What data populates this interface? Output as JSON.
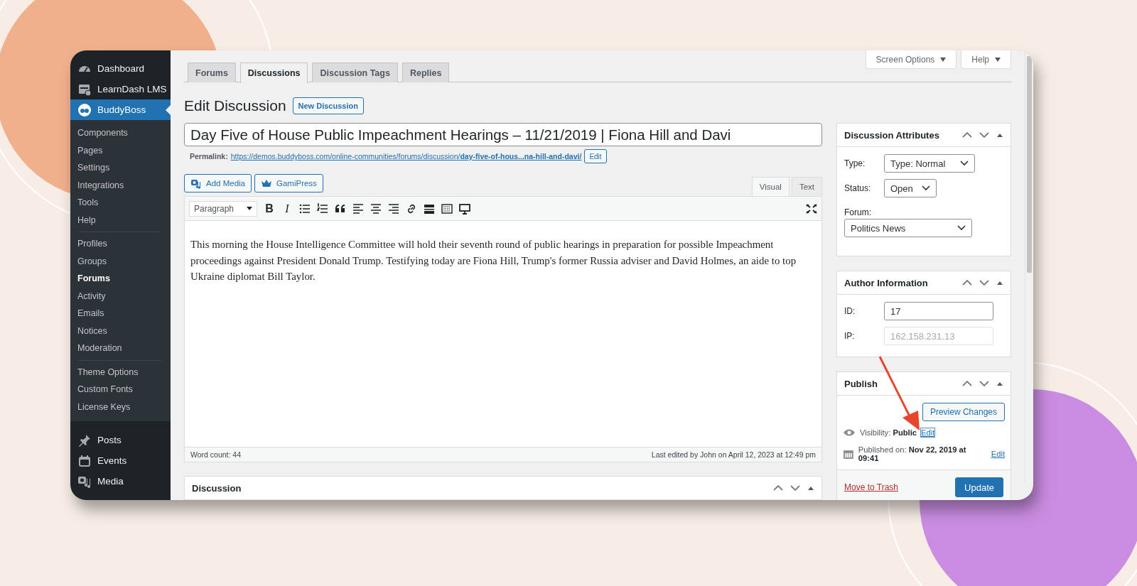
{
  "sidebar": {
    "top_items": [
      {
        "label": "Dashboard",
        "selected": false
      },
      {
        "label": "LearnDash LMS",
        "selected": false
      },
      {
        "label": "BuddyBoss",
        "selected": true
      }
    ],
    "submenu_groups": [
      [
        {
          "label": "Components",
          "selected": false
        },
        {
          "label": "Pages",
          "selected": false
        },
        {
          "label": "Settings",
          "selected": false
        },
        {
          "label": "Integrations",
          "selected": false
        },
        {
          "label": "Tools",
          "selected": false
        },
        {
          "label": "Help",
          "selected": false
        }
      ],
      [
        {
          "label": "Profiles",
          "selected": false
        },
        {
          "label": "Groups",
          "selected": false
        },
        {
          "label": "Forums",
          "selected": true
        },
        {
          "label": "Activity",
          "selected": false
        },
        {
          "label": "Emails",
          "selected": false
        },
        {
          "label": "Notices",
          "selected": false
        },
        {
          "label": "Moderation",
          "selected": false
        }
      ],
      [
        {
          "label": "Theme Options",
          "selected": false
        },
        {
          "label": "Custom Fonts",
          "selected": false
        },
        {
          "label": "License Keys",
          "selected": false
        }
      ]
    ],
    "bottom_items": [
      {
        "label": "Posts",
        "selected": false
      },
      {
        "label": "Events",
        "selected": false
      },
      {
        "label": "Media",
        "selected": false
      }
    ]
  },
  "screen_meta_buttons": [
    "Screen Options",
    "Help"
  ],
  "tabs": [
    {
      "label": "Forums",
      "selected": false
    },
    {
      "label": "Discussions",
      "selected": true
    },
    {
      "label": "Discussion Tags",
      "selected": false
    },
    {
      "label": "Replies",
      "selected": false
    }
  ],
  "heading": "Edit Discussion",
  "new_button": "New Discussion",
  "title_field": {
    "value": "Day Five of House Public Impeachment Hearings – 11/21/2019 | Fiona Hill and Davi"
  },
  "permalink": {
    "label": "Permalink:",
    "url": "https://demos.buddyboss.com/online-communities/forums/discussion/**day-five-of-hous...na-hill-and-davi/**",
    "edit_button": "Edit"
  },
  "media_buttons": [
    "Add Media",
    "GamiPress"
  ],
  "editor": {
    "tabs": [
      {
        "label": "Visual",
        "selected": true
      },
      {
        "label": "Text",
        "selected": false
      }
    ],
    "format_select": "Paragraph",
    "format_buttons": [
      "B",
      "I"
    ],
    "content": "This morning the House Intelligence Committee will hold their seventh round of public hearings in preparation for possible Impeachment proceedings against President Donald Trump. Testifying today are Fiona Hill, Trump's former Russia adviser and David Holmes, an aide to top Ukraine diplomat Bill Taylor.",
    "word_count": "Word count: 44",
    "last_edited": "Last edited by John on April 12, 2023 at 12:49 pm"
  },
  "discussion_box": {
    "title": "Discussion"
  },
  "discussion_attributes": {
    "title": "Discussion Attributes",
    "type": {
      "label": "Type:",
      "value": "Type: Normal"
    },
    "status": {
      "label": "Status:",
      "value": "Open"
    },
    "forum": {
      "label": "Forum:",
      "value": "Politics News"
    }
  },
  "author_information": {
    "title": "Author Information",
    "fields": [
      {
        "label": "ID:",
        "value": "17",
        "disabled": false
      },
      {
        "label": "IP:",
        "value": "162.158.231.13",
        "disabled": true
      }
    ]
  },
  "publish": {
    "title": "Publish",
    "preview_button": "Preview Changes",
    "visibility": "Visibility: **Public**",
    "visibility_edit": {
      "label": "Edit",
      "focused": true
    },
    "published_on": "Published on: **Nov 22, 2019 at 09:41**",
    "published_edit": {
      "label": "Edit",
      "focused": false
    },
    "trash_link": "Move to Trash",
    "update_button": "Update"
  }
}
